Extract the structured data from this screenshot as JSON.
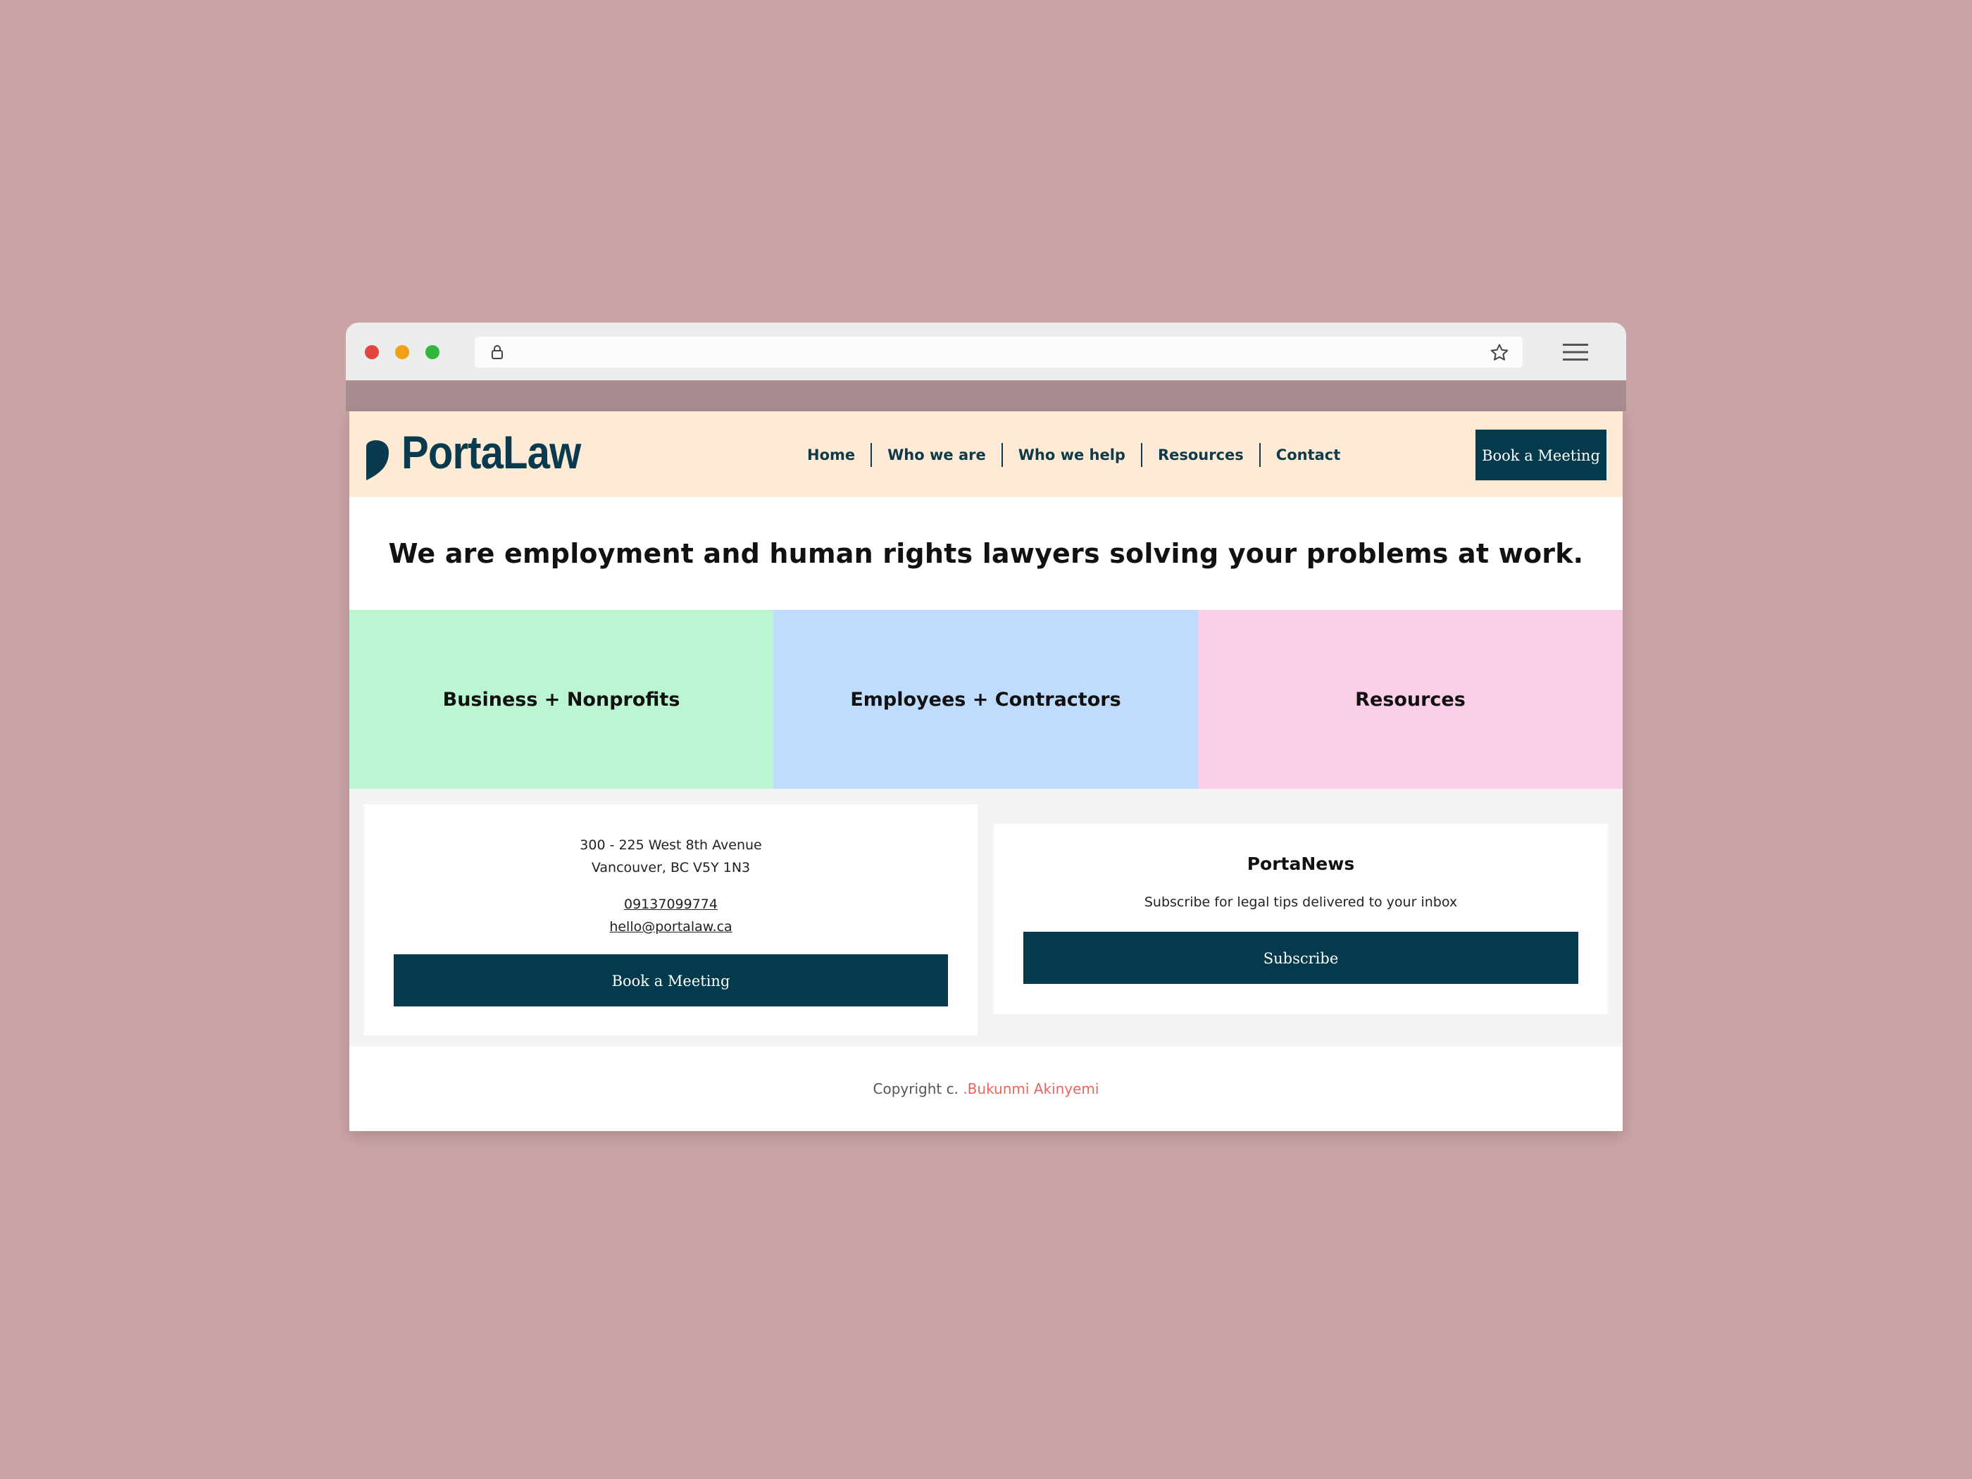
{
  "browser": {
    "address_url": "",
    "icons": [
      "lock-icon",
      "star-icon",
      "hamburger-menu-icon"
    ]
  },
  "nav": {
    "logo_text": "PortaLaw",
    "links": [
      "Home",
      "Who we are",
      "Who we help",
      "Resources",
      "Contact"
    ],
    "cta": "Book a Meeting"
  },
  "hero": {
    "headline": "We are employment and human rights lawyers solving your problems at work."
  },
  "tiles": [
    {
      "label": "Business + Nonprofits",
      "color": "#bbf5d1"
    },
    {
      "label": "Employees + Contractors",
      "color": "#bfdbfd"
    },
    {
      "label": "Resources",
      "color": "#fbcfe8"
    }
  ],
  "contact": {
    "address_line1": "300 - 225 West 8th Avenue",
    "address_line2": "Vancouver, BC V5Y 1N3",
    "phone": "09137099774",
    "email": "hello@portalaw.ca",
    "button": "Book a Meeting"
  },
  "newsletter": {
    "title": "PortaNews",
    "subtitle": "Subscribe for legal tips delivered to your inbox",
    "button": "Subscribe"
  },
  "footer": {
    "prefix": "Copyright c.",
    "author": ".Bukunmi Akinyemi"
  },
  "colors": {
    "brand": "#043a4b",
    "nav_bg": "#fdebd5",
    "page_bg": "#c9a3a5",
    "accent_link": "#e8645f"
  }
}
